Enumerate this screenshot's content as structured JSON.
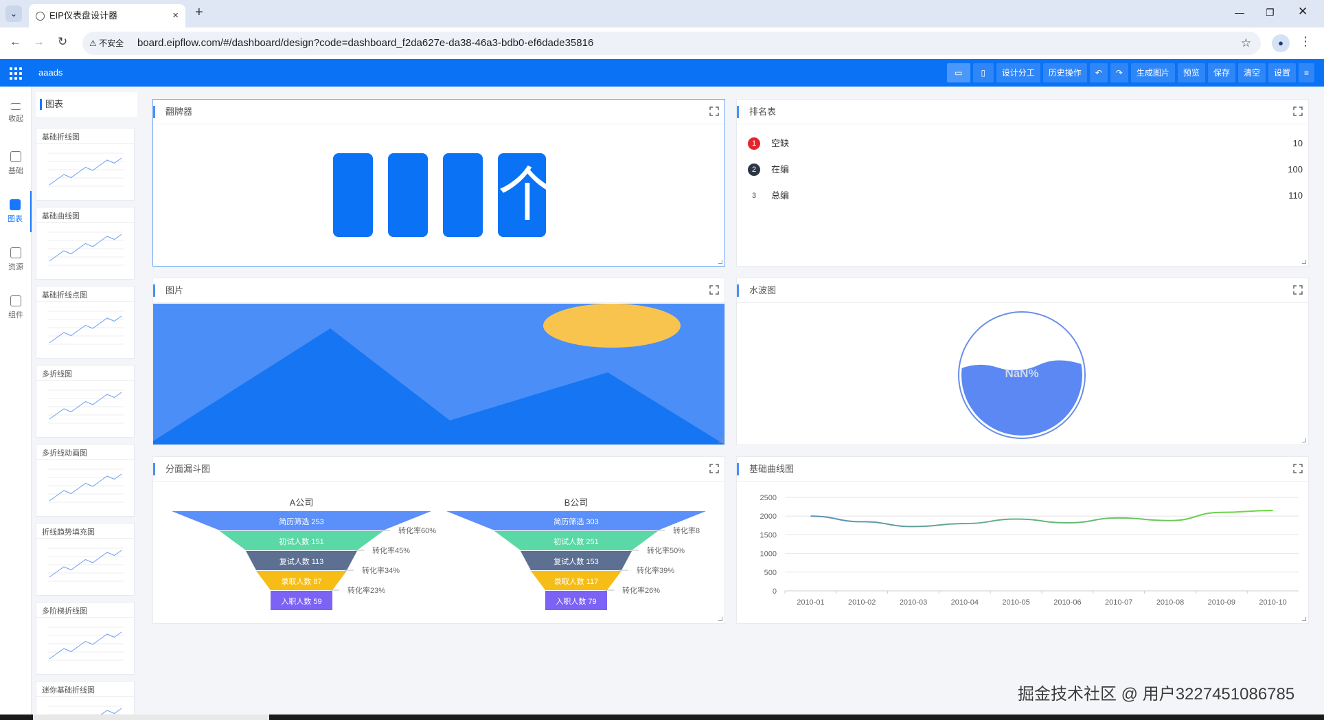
{
  "browser": {
    "tab_title": "EIP仪表盘设计器",
    "new_tab": "+",
    "url_warning": "不安全",
    "url": "board.eipflow.com/#/dashboard/design?code=dashboard_f2da627e-da38-46a3-bdb0-ef6dade35816"
  },
  "app": {
    "name": "aaads",
    "toolbar": [
      "设计分工",
      "历史操作",
      "生成图片",
      "预览",
      "保存",
      "清空",
      "设置"
    ]
  },
  "rail": [
    "收起",
    "基础",
    "图表",
    "资源",
    "组件"
  ],
  "library": {
    "header": "图表",
    "cards": [
      "基础折线图",
      "基础曲线图",
      "基础折线点图",
      "多折线图",
      "多折线动画图",
      "折线趋势填充图",
      "多阶梯折线图",
      "迷你基础折线图"
    ]
  },
  "panels": {
    "flip": {
      "title": "翻牌器",
      "digits": [
        "",
        "",
        "",
        "个"
      ]
    },
    "rank": {
      "title": "排名表",
      "rows": [
        {
          "rank": "1",
          "name": "空缺",
          "value": "10"
        },
        {
          "rank": "2",
          "name": "在编",
          "value": "100"
        },
        {
          "rank": "3",
          "name": "总编",
          "value": "110"
        }
      ]
    },
    "image": {
      "title": "图片"
    },
    "liquid": {
      "title": "水波图",
      "value": "NaN%"
    },
    "funnel": {
      "title": "分面漏斗图"
    },
    "curve": {
      "title": "基础曲线图"
    }
  },
  "chart_data": [
    {
      "type": "funnel",
      "title": "A公司",
      "stages": [
        {
          "label": "简历筛选 253",
          "value": 253
        },
        {
          "label": "初试人数 151",
          "value": 151
        },
        {
          "label": "复试人数 113",
          "value": 113
        },
        {
          "label": "录取人数 87",
          "value": 87
        },
        {
          "label": "入职人数 59",
          "value": 59
        }
      ],
      "rates": [
        "转化率60%",
        "转化率45%",
        "转化率34%",
        "转化率23%"
      ],
      "colors": [
        "#5b8ff9",
        "#5ad8a6",
        "#5d7092",
        "#f6bd16",
        "#7c62f5"
      ]
    },
    {
      "type": "funnel",
      "title": "B公司",
      "stages": [
        {
          "label": "简历筛选 303",
          "value": 303
        },
        {
          "label": "初试人数 251",
          "value": 251
        },
        {
          "label": "复试人数 153",
          "value": 153
        },
        {
          "label": "录取人数 117",
          "value": 117
        },
        {
          "label": "入职人数 79",
          "value": 79
        }
      ],
      "rates": [
        "转化率8",
        "转化率50%",
        "转化率39%",
        "转化率26%"
      ],
      "colors": [
        "#5b8ff9",
        "#5ad8a6",
        "#5d7092",
        "#f6bd16",
        "#7c62f5"
      ]
    },
    {
      "type": "line",
      "categories": [
        "2010-01",
        "2010-02",
        "2010-03",
        "2010-04",
        "2010-05",
        "2010-06",
        "2010-07",
        "2010-08",
        "2010-09",
        "2010-10"
      ],
      "values": [
        2000,
        1850,
        1720,
        1800,
        1920,
        1820,
        1950,
        1880,
        2100,
        2150
      ],
      "yticks": [
        "2500",
        "2000",
        "1500",
        "1000",
        "500",
        "0"
      ],
      "ylim": [
        0,
        2500
      ]
    }
  ],
  "watermark": "掘金技术社区 @ 用户3227451086785"
}
